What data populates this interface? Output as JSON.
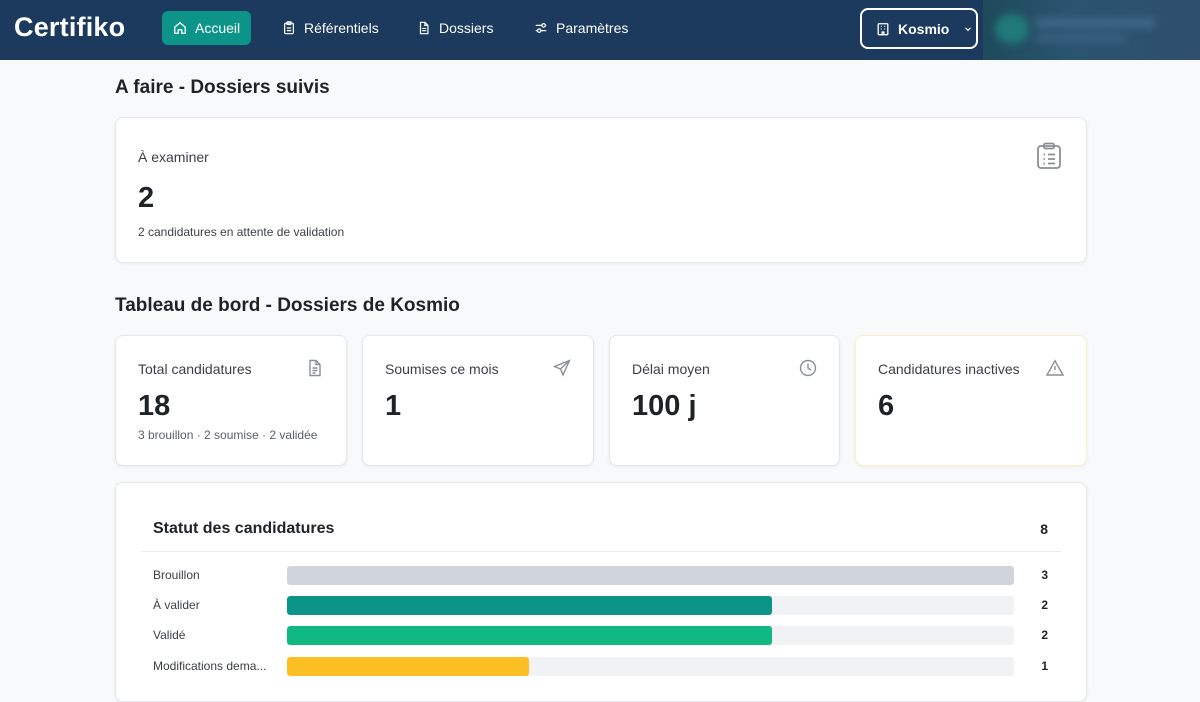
{
  "app": {
    "brand": "Certifiko"
  },
  "nav": {
    "items": [
      {
        "label": "Accueil",
        "icon": "home-icon",
        "active": true
      },
      {
        "label": "Référentiels",
        "icon": "clipboard-icon",
        "active": false
      },
      {
        "label": "Dossiers",
        "icon": "file-icon",
        "active": false
      },
      {
        "label": "Paramètres",
        "icon": "sliders-icon",
        "active": false
      }
    ],
    "org": {
      "label": "Kosmio",
      "icon": "building-icon"
    }
  },
  "todo": {
    "title": "A faire - Dossiers suivis",
    "card": {
      "label": "À examiner",
      "value": "2",
      "sub": "2 candidatures en attente de validation",
      "icon": "clipboard-list-icon"
    }
  },
  "dashboard": {
    "title": "Tableau de bord - Dossiers de Kosmio",
    "stats": [
      {
        "label": "Total candidatures",
        "value": "18",
        "sub": "3 brouillon · 2 soumise · 2 validée",
        "icon": "document-icon"
      },
      {
        "label": "Soumises ce mois",
        "value": "1",
        "sub": "",
        "icon": "send-icon"
      },
      {
        "label": "Délai moyen",
        "value": "100 j",
        "sub": "",
        "icon": "clock-icon"
      },
      {
        "label": "Candidatures inactives",
        "value": "6",
        "sub": "",
        "icon": "warning-icon"
      }
    ]
  },
  "status": {
    "title": "Statut des candidatures",
    "total": "8",
    "max": 3,
    "rows": [
      {
        "label": "Brouillon",
        "count": 3,
        "color": "#d1d5db"
      },
      {
        "label": "À valider",
        "count": 2,
        "color": "#0d9488"
      },
      {
        "label": "Validé",
        "count": 2,
        "color": "#10b981"
      },
      {
        "label": "Modifications dema...",
        "count": 1,
        "color": "#fbbf24"
      }
    ]
  },
  "colors": {
    "nav_bg": "#1c3a5e",
    "accent": "#0d9488",
    "warning_border": "#fdf1c7"
  }
}
